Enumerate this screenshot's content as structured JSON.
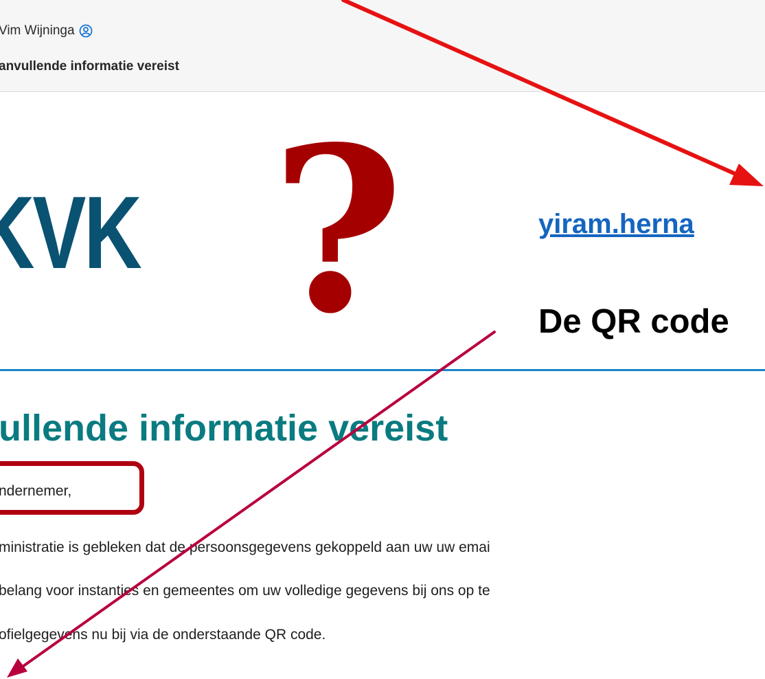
{
  "email": {
    "sender": "Vim Wijninga",
    "subject": "anvullende informatie vereist"
  },
  "logo": {
    "text": "KVK"
  },
  "annotations": {
    "question_mark": "?",
    "link_text": "yiram.herna",
    "qr_caption": "De QR code"
  },
  "body": {
    "heading": "ullende informatie vereist",
    "lines": [
      "ndernemer,",
      "ministratie is gebleken dat de persoonsgegevens gekoppeld aan uw uw emai",
      "belang voor instanties en gemeentes om uw volledige gegevens bij ons op te",
      "ofielgegevens nu bij via de onderstaande QR code."
    ]
  },
  "colors": {
    "logo": "#0a5272",
    "question_mark": "#a50000",
    "link": "#1565c0",
    "heading": "#0a7b80",
    "divider": "#1a84c6",
    "red_arrow": "#e61212",
    "crimson_arrow": "#b8003c",
    "greeting_box": "#b00010"
  },
  "icons": [
    "user-contact-icon"
  ]
}
